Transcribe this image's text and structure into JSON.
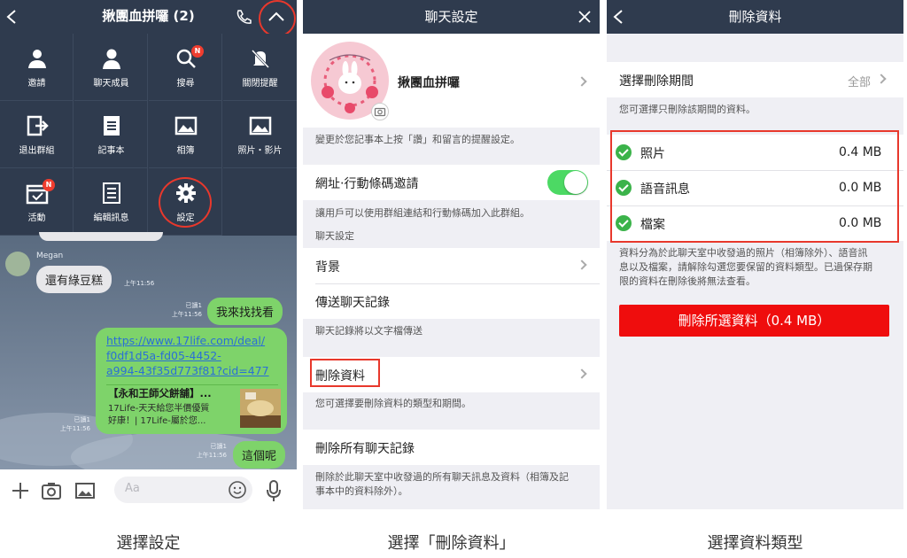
{
  "panel1": {
    "title": "揪團血拼囉 (2)",
    "menu_items": [
      {
        "label": "邀請",
        "icon": "person-add-icon"
      },
      {
        "label": "聊天成員",
        "icon": "person-icon"
      },
      {
        "label": "搜尋",
        "icon": "search-icon",
        "badge": "N"
      },
      {
        "label": "關閉提醒",
        "icon": "mute-icon"
      },
      {
        "label": "退出群組",
        "icon": "exit-icon"
      },
      {
        "label": "記事本",
        "icon": "note-icon"
      },
      {
        "label": "相簿",
        "icon": "album-icon"
      },
      {
        "label": "照片・影片",
        "icon": "photo-icon"
      },
      {
        "label": "活動",
        "icon": "calendar-icon",
        "badge": "N"
      },
      {
        "label": "編輯訊息",
        "icon": "edit-list-icon"
      },
      {
        "label": "設定",
        "icon": "gear-icon"
      }
    ],
    "messages": {
      "sender": "Megan",
      "in_text": "還有綠豆糕",
      "in_time": "上午11:56",
      "out1_text": "我來找找看",
      "out1_read": "已讀1",
      "out1_time": "上午11:56",
      "link_url": "https://www.17life.com/deal/f0df1d5a-fd05-4452-a994-43f35d773f81?cid=477",
      "link_url_l1": "https://www.17life.com/deal/",
      "link_url_l2": "f0df1d5a-fd05-4452-",
      "link_url_l3": "a994-43f35d773f81?cid=477",
      "preview_title": "【永和王師父餅舖】...",
      "preview_desc_l1": "17Life-天天給您半價優質",
      "preview_desc_l2": "好康！| 17Life-屬於您...",
      "link_read": "已讀1",
      "link_time": "上午11:56",
      "out2_text": "這個呢",
      "out2_read": "已讀1",
      "out2_time": "上午11:56"
    },
    "input_placeholder": "Aa",
    "caption": "選擇設定"
  },
  "panel2": {
    "title": "聊天設定",
    "group_name": "揪團血拼囉",
    "group_note": "變更於您記事本上按「讚」和留言的提醒設定。",
    "invite_label": "網址‧行動條碼邀請",
    "invite_toggle_on": true,
    "invite_note": "讓用戶可以使用群組連結和行動條碼加入此群組。",
    "section_header": "聊天設定",
    "background_label": "背景",
    "send_history_label": "傳送聊天記錄",
    "send_history_note": "聊天記錄將以文字檔傳送",
    "delete_data_label": "刪除資料",
    "delete_data_note": "您可選擇要刪除資料的類型和期間。",
    "delete_all_label": "刪除所有聊天記錄",
    "delete_all_note_l1": "刪除於此聊天室中收發過的所有聊天訊息及資料（相簿及記",
    "delete_all_note_l2": "事本中的資料除外）。",
    "caption": "選擇「刪除資料」"
  },
  "panel3": {
    "title": "刪除資料",
    "period_label": "選擇刪除期間",
    "period_value": "全部",
    "period_note": "您可選擇只刪除該期間的資料。",
    "items": [
      {
        "label": "照片",
        "size": "0.4 MB",
        "checked": true
      },
      {
        "label": "語音訊息",
        "size": "0.0 MB",
        "checked": true
      },
      {
        "label": "檔案",
        "size": "0.0 MB",
        "checked": true
      }
    ],
    "info_l1": "資料分為於此聊天室中收發過的照片（相簿除外）、語音訊",
    "info_l2": "息以及檔案，請解除勾選您要保留的資料類型。已過保存期",
    "info_l3": "限的資料在刪除後將無法查看。",
    "delete_button": "刪除所選資料（0.4 MB）",
    "caption": "選擇資料類型"
  },
  "colors": {
    "nav_dark": "#2f3b4e",
    "highlight_red": "#e8382c",
    "line_green": "#7ed36a",
    "toggle_green": "#4cd964",
    "check_green": "#3bb34a",
    "delete_red": "#ef0d0d"
  }
}
